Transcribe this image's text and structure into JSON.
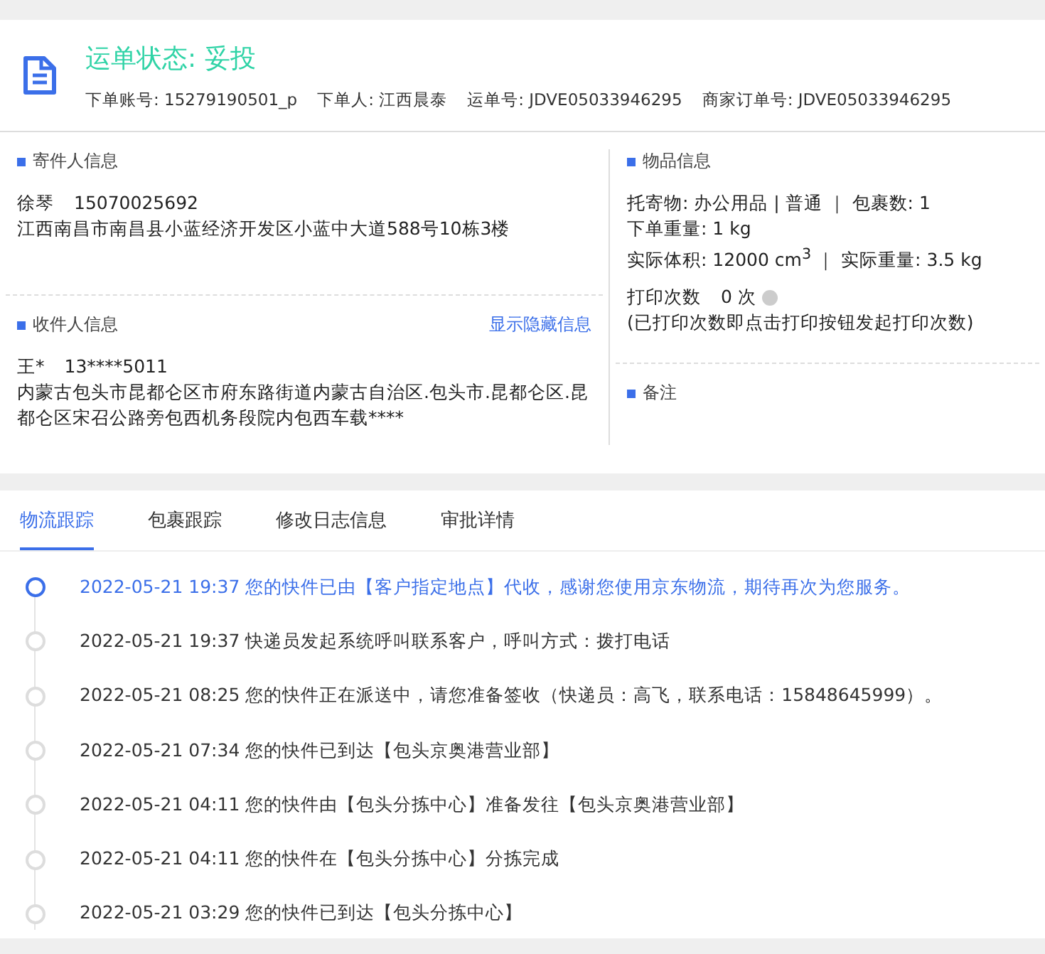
{
  "header": {
    "status": "运单状态: 妥投",
    "meta": [
      {
        "label": "下单账号:",
        "value": "15279190501_p"
      },
      {
        "label": "下单人:",
        "value": "江西晨泰"
      },
      {
        "label": "运单号:",
        "value": "JDVE05033946295"
      },
      {
        "label": "商家订单号:",
        "value": "JDVE05033946295"
      }
    ]
  },
  "sender": {
    "title": "寄件人信息",
    "name": "徐琴",
    "phone": "15070025692",
    "address": "江西南昌市南昌县小蓝经济开发区小蓝中大道588号10栋3楼"
  },
  "receiver": {
    "title": "收件人信息",
    "link": "显示隐藏信息",
    "name": "王*",
    "phone": "13****5011",
    "address": "内蒙古包头市昆都仑区市府东路街道内蒙古自治区.包头市.昆都仑区.昆都仑区宋召公路旁包西机务段院内包西车载****"
  },
  "goods": {
    "title": "物品信息",
    "lines": [
      "托寄物: 办公用品 | 普通 ｜ 包裹数: 1",
      "下单重量: 1 kg",
      "实际体积:  12000 cm$^{3}$ ｜ 实际重量: 3.5 kg"
    ],
    "print_label": "打印次数",
    "print_count": "0 次",
    "print_note": "(已打印次数即点击打印按钮发起打印次数)"
  },
  "remarks": {
    "title": "备注"
  },
  "tabs": [
    {
      "label": "物流跟踪",
      "selected": true
    },
    {
      "label": "包裹跟踪",
      "selected": false
    },
    {
      "label": "修改日志信息",
      "selected": false
    },
    {
      "label": "审批详情",
      "selected": false
    }
  ],
  "timeline": [
    {
      "text": "2022-05-21 19:37 您的快件已由【客户指定地点】代收，感谢您使用京东物流，期待再次为您服务。",
      "selected": true
    },
    {
      "text": "2022-05-21 19:37 快递员发起系统呼叫联系客户，呼叫方式：拨打电话",
      "selected": false
    },
    {
      "text": "2022-05-21 08:25 您的快件正在派送中，请您准备签收（快递员：高飞，联系电话：15848645999）。",
      "selected": false
    },
    {
      "text": "2022-05-21 07:34 您的快件已到达【包头京奥港营业部】",
      "selected": false
    },
    {
      "text": "2022-05-21 04:11 您的快件由【包头分拣中心】准备发往【包头京奥港营业部】",
      "selected": false
    },
    {
      "text": "2022-05-21 04:11 您的快件在【包头分拣中心】分拣完成",
      "selected": false
    },
    {
      "text": "2022-05-21 03:29 您的快件已到达【包头分拣中心】",
      "selected": false
    }
  ]
}
